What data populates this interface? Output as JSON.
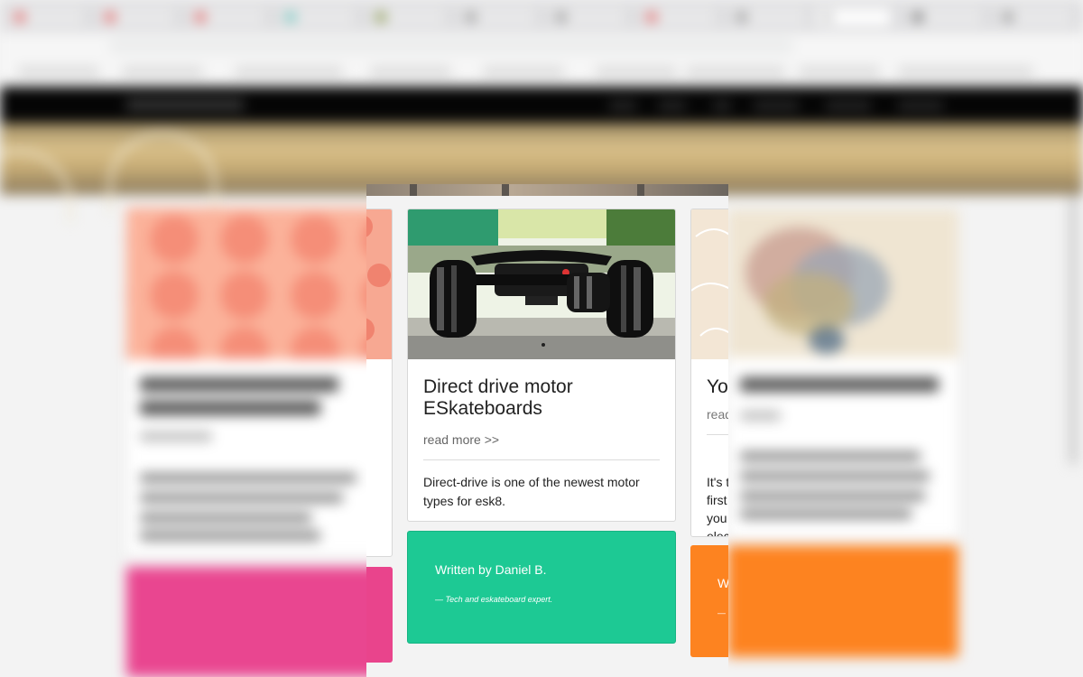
{
  "colors": {
    "author_green": "#1dc994",
    "author_pink": "#e9448c",
    "author_orange": "#fd8320",
    "nav_black": "#050505"
  },
  "main_card": {
    "image_subject": "electric skateboard rear wheels",
    "title": "Direct drive motor ESkateboards",
    "read_more": "read more >>",
    "excerpt": "Direct-drive is one of the newest motor types for esk8."
  },
  "author_box": {
    "written_by": "Written by Daniel B.",
    "role": "— Tech and eskateboard expert."
  },
  "right_card_fragment": {
    "title_start": "You",
    "read_more_start": "read",
    "excerpt_line_starts": [
      "It's t",
      "first",
      "you",
      "elec"
    ],
    "author_start": "W",
    "dash": "—"
  },
  "icons": {
    "wheel": "wheel-icon"
  }
}
